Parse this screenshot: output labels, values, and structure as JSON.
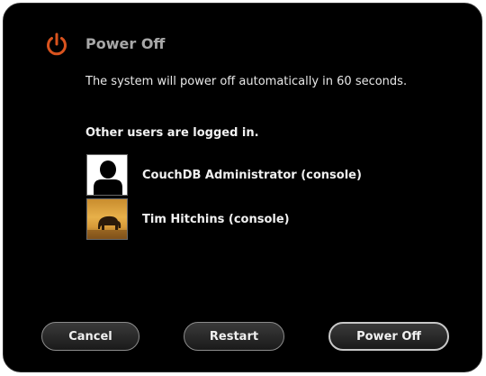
{
  "dialog": {
    "title": "Power Off",
    "message": "The system will power off automatically in 60 seconds.",
    "icon": "power-icon",
    "accent_color": "#d9531e"
  },
  "users": {
    "heading": "Other users are logged in.",
    "items": [
      {
        "name": "CouchDB Administrator (console)",
        "avatar": "default-user-avatar"
      },
      {
        "name": "Tim Hitchins (console)",
        "avatar": "elephant-photo-avatar"
      }
    ]
  },
  "buttons": {
    "cancel": "Cancel",
    "restart": "Restart",
    "power_off": "Power Off"
  }
}
